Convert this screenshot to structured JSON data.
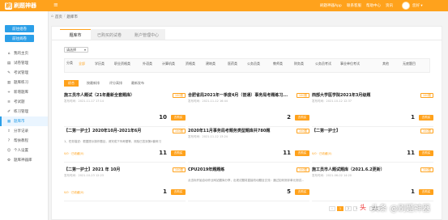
{
  "brand": {
    "logo_char": "刷",
    "name": "刷题神器"
  },
  "colors": {
    "accent": "#ffa21c",
    "blue": "#2b9fe8"
  },
  "topnav": [
    "刷题神器App",
    "联系客服",
    "帮助中心",
    "资讯"
  ],
  "user": {
    "name": "您好 ▾"
  },
  "sidebar": {
    "buttons": [
      "前往组卷",
      "前往阅卷"
    ],
    "items": [
      {
        "label": "我的主页",
        "icon": "home-icon"
      },
      {
        "label": "试卷管理",
        "icon": "document-icon"
      },
      {
        "label": "考试管理",
        "icon": "pen-icon"
      },
      {
        "label": "题库练习",
        "icon": "book-icon"
      },
      {
        "label": "新增题库",
        "icon": "plus-icon"
      },
      {
        "label": "考试题",
        "icon": "list-icon"
      },
      {
        "label": "练习管理",
        "icon": "edit-icon"
      },
      {
        "label": "题库市",
        "icon": "store-icon"
      },
      {
        "label": "分享记录",
        "icon": "share-icon"
      },
      {
        "label": "帮扶教程",
        "icon": "help-icon"
      },
      {
        "label": "个人设置",
        "icon": "user-icon"
      },
      {
        "label": "题库神器库",
        "icon": "gear-icon"
      }
    ],
    "active_index": 7
  },
  "breadcrumb": {
    "icon": "home-icon",
    "items": [
      "首页",
      "题库市"
    ]
  },
  "tabs": [
    "题库市",
    "已购买的试卷",
    "账户管理中心"
  ],
  "search": {
    "select": "请选择"
  },
  "filter": {
    "label": "分类",
    "categories": [
      "全部",
      "学历类",
      "职业资格类",
      "外语类",
      "计算机类",
      "资格类",
      "建筑类",
      "医药类",
      "公务员类",
      "教师类",
      "财务类",
      "公务员考试",
      "事业单位考试",
      "其他",
      "无底题目"
    ]
  },
  "subtabs": [
    "综合",
    "按最新排",
    "评分高排",
    "最新发布"
  ],
  "cards": [
    {
      "title": "施工员市人题试（21年最新全套题库）",
      "date": "发布时间：2021-11-17 17:14",
      "desc": "",
      "badge": "100题",
      "fav": "",
      "num": "10",
      "btn": "去购买"
    },
    {
      "title": "合肥省局2021年一季度4月（普通）事务局考题练习...",
      "date": "发布时间：2021-11-12 16:44",
      "desc": "",
      "badge": "100题",
      "fav": "",
      "num": "2",
      "btn": "去购买"
    },
    {
      "title": "西部大学医学院2021年3月级题",
      "date": "发布时间：2021-10-12 12:37",
      "desc": "",
      "badge": "100题",
      "fav": "",
      "num": "1",
      "btn": "去购买"
    },
    {
      "title": "【二第一护士】2020年10月-2021年6月",
      "date": "",
      "desc": "1、任务描述：根据提示操作题目，请完成下列考题等，测验已答到第4套练习",
      "badge": "100题",
      "fav": "0/0 · 已收藏(0)",
      "num": "11",
      "btn": "去购买"
    },
    {
      "title": "2020年11月事务局考题务类型题库共780题",
      "date": "发布时间：2021-11-12 13:24",
      "desc": "",
      "badge": "100题",
      "fav": "",
      "num": "11",
      "btn": "去购买"
    },
    {
      "title": "【二第一护士】",
      "date": "",
      "desc": "",
      "badge": "100题",
      "fav": "0/0 · 已收藏(0)",
      "num": "11",
      "btn": "去购买"
    },
    {
      "title": "【二第一护士】2021 年 10月",
      "date": "发布时间：2021-10-23 12:23",
      "desc": "",
      "badge": "100题",
      "fav": "0/0 · 已收藏(0)",
      "num": "1",
      "btn": "去购买"
    },
    {
      "title": "CPU2019年题题练",
      "date": "",
      "desc": "点击标开始自动作业网站题库分享，出现试题将直接改动题目交流：通过如何测评单元测试...",
      "badge": "100题",
      "fav": "",
      "num": "5",
      "btn": "去购买"
    },
    {
      "title": "施工员市人题试题库（2021.6.2更新）",
      "date": "发布时间：2021-06-02 14:20",
      "desc": "",
      "badge": "100题",
      "fav": "",
      "num": "1",
      "btn": "去购买"
    }
  ],
  "pagination": [
    "‹",
    "1",
    "2",
    "3",
    "›",
    "跳转"
  ],
  "watermark": {
    "logo": "头",
    "text": "头条 @刷题神器"
  }
}
